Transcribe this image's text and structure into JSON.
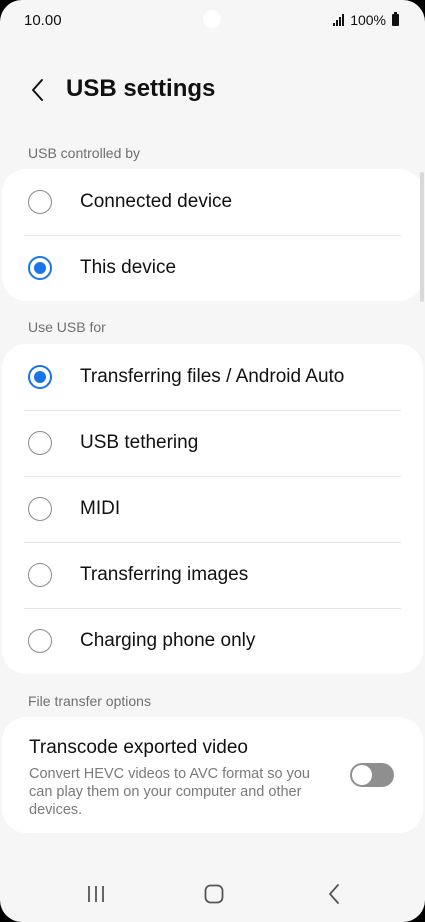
{
  "status_bar": {
    "time": "10.00",
    "battery": "100%"
  },
  "header": {
    "title": "USB settings"
  },
  "controlled_by": {
    "label": "USB controlled by",
    "options": [
      {
        "label": "Connected device",
        "selected": false
      },
      {
        "label": "This device",
        "selected": true
      }
    ]
  },
  "use_usb_for": {
    "label": "Use USB for",
    "options": [
      {
        "label": "Transferring files / Android Auto",
        "selected": true
      },
      {
        "label": "USB tethering",
        "selected": false
      },
      {
        "label": "MIDI",
        "selected": false
      },
      {
        "label": "Transferring images",
        "selected": false
      },
      {
        "label": "Charging phone only",
        "selected": false
      }
    ]
  },
  "file_transfer": {
    "label": "File transfer options",
    "title": "Transcode exported video",
    "description": "Convert HEVC videos to AVC format so you can play them on your computer and other devices.",
    "enabled": false
  },
  "colors": {
    "accent": "#1a73e8",
    "toggle_off": "#8f8f8f"
  },
  "icons": {
    "back": "chevron-left-icon",
    "nav_recents": "recent-apps-icon",
    "nav_home": "home-icon",
    "nav_back": "back-icon"
  }
}
